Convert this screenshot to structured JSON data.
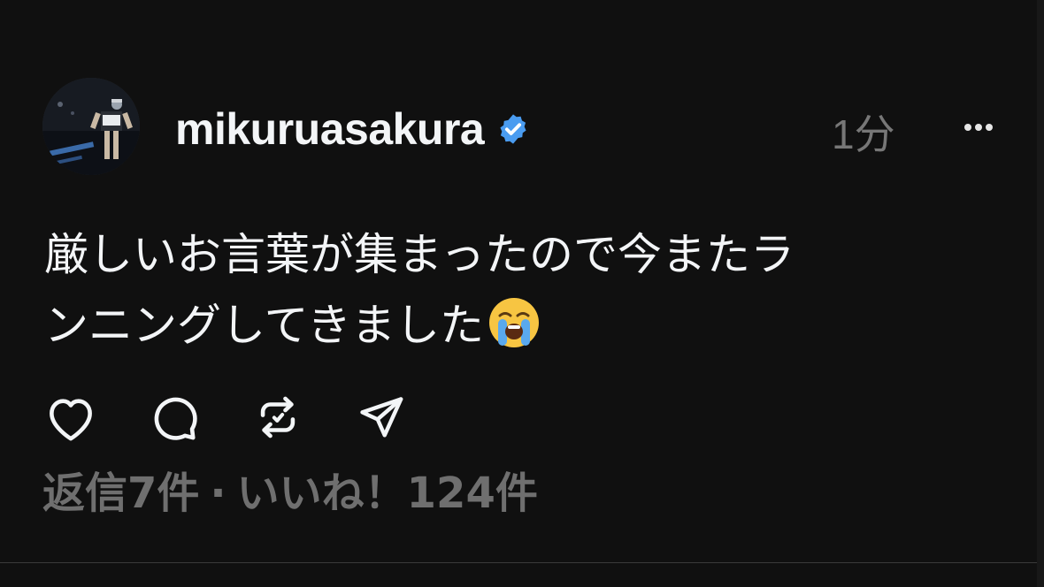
{
  "post": {
    "username": "mikuruasakura",
    "verified_icon": "verified-badge-icon",
    "timestamp": "1分",
    "more_icon": "more-horizontal-icon",
    "text_line1": "厳しいお言葉が集まったので今またラ",
    "text_line2": "ンニングしてきました",
    "emoji_icon": "loudly-crying-face-icon",
    "actions": {
      "like_icon": "heart-icon",
      "reply_icon": "comment-icon",
      "repost_icon": "repost-icon",
      "share_icon": "send-icon"
    },
    "stats": {
      "replies": "返信7件",
      "separator": "·",
      "likes": "いいね！124件"
    },
    "colors": {
      "background": "#101010",
      "text": "#f3f5f7",
      "muted": "#777777",
      "verified": "#4a9cf0"
    }
  }
}
